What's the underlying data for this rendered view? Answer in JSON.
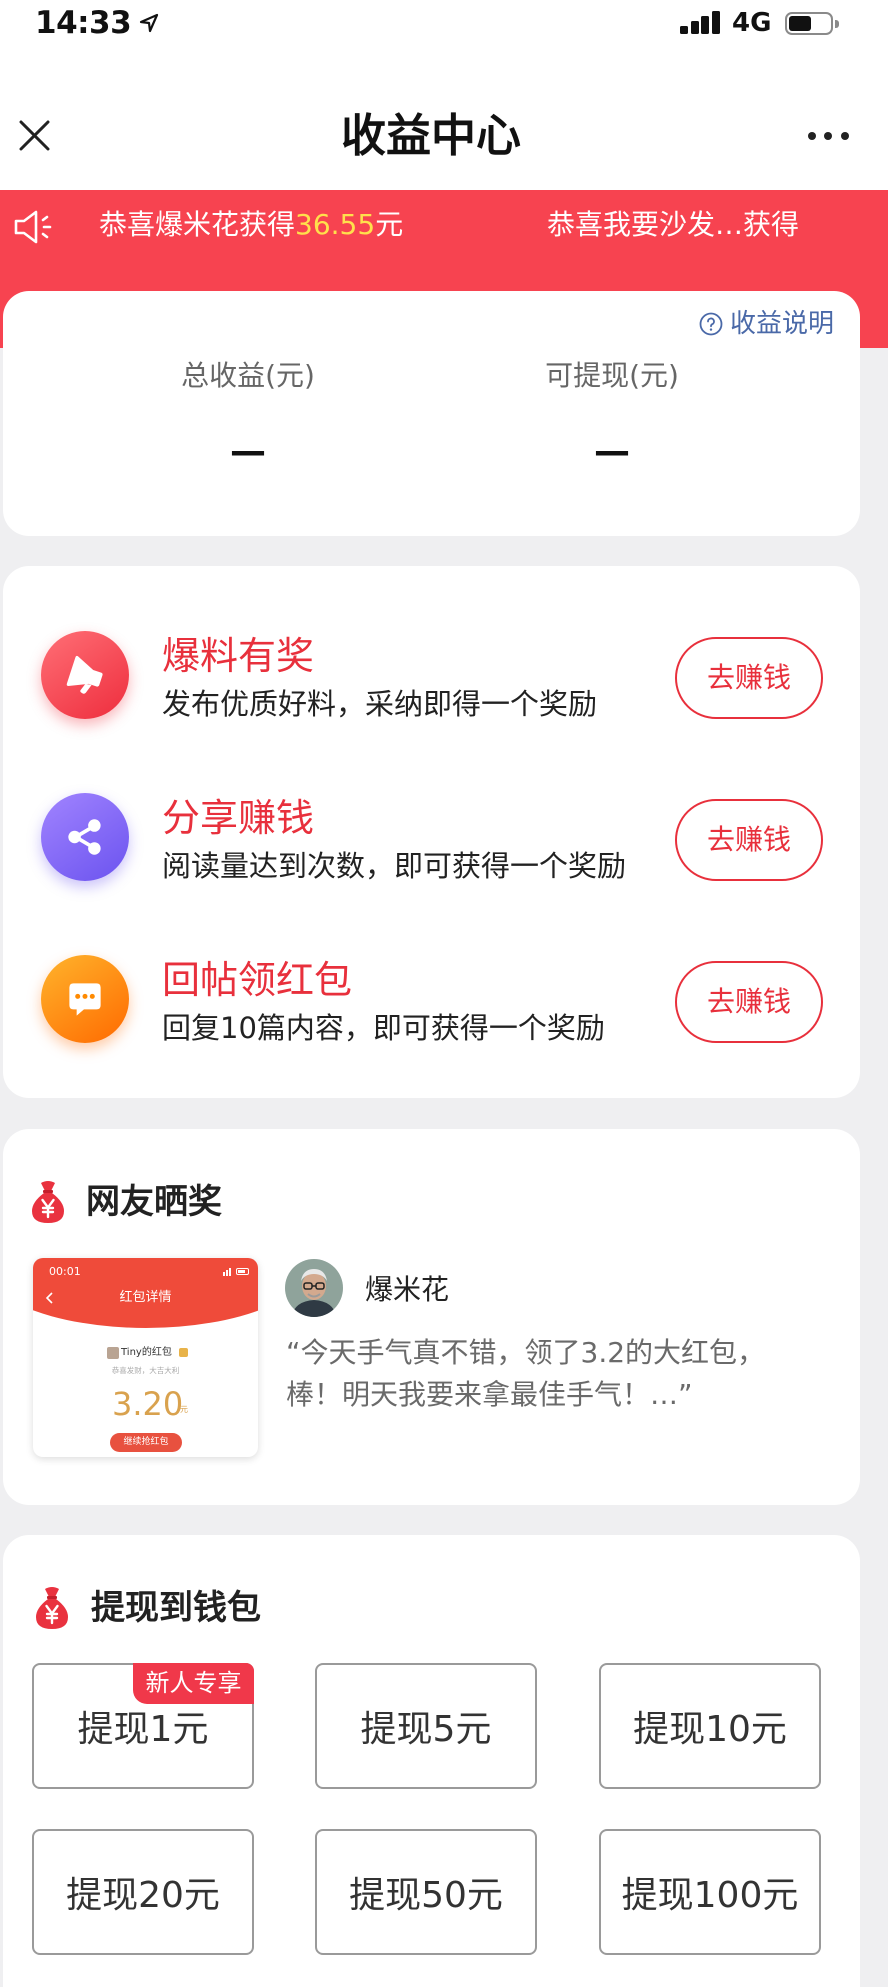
{
  "status_bar": {
    "time": "14:33",
    "network": "4G",
    "battery_level": 0.5
  },
  "header": {
    "title": "收益中心",
    "close_icon": "close-icon",
    "more_icon": "more-icon"
  },
  "ticker": {
    "icon": "speaker-icon",
    "items": [
      {
        "prefix": "恭喜爆米花获得",
        "amount": "36.55",
        "suffix": "元"
      },
      {
        "text": "恭喜我要沙发…获得"
      }
    ]
  },
  "earnings": {
    "help_label": "收益说明",
    "help_icon": "question-circle-icon",
    "total_label": "总收益(元)",
    "total_value": "—",
    "withdrawable_label": "可提现(元)",
    "withdrawable_value": "—"
  },
  "tasks": [
    {
      "icon": "megaphone-icon",
      "title": "爆料有奖",
      "desc": "发布优质好料，采纳即得一个奖励",
      "button": "去赚钱"
    },
    {
      "icon": "share-icon",
      "title": "分享赚钱",
      "desc": "阅读量达到次数，即可获得一个奖励",
      "button": "去赚钱"
    },
    {
      "icon": "chat-bubble-icon",
      "title": "回帖领红包",
      "desc": "回复10篇内容，即可获得一个奖励",
      "button": "去赚钱"
    }
  ],
  "showcase": {
    "icon": "money-bag-icon",
    "title": "网友晒奖",
    "user_name": "爆米花",
    "quote_lines": [
      "“今天手气真不错，领了3.2的大红包，",
      "棒！明天我要来拿最佳手气！…”"
    ],
    "thumbnail": {
      "time": "00:01",
      "title": "红包详情",
      "owner": "Tiny的红包",
      "greeting": "恭喜发财，大吉大利",
      "amount": "3.20",
      "unit": "元",
      "button": "继续抢红包"
    }
  },
  "withdraw": {
    "icon": "money-bag-icon",
    "title": "提现到钱包",
    "badge": "新人专享",
    "options": [
      "提现1元",
      "提现5元",
      "提现10元",
      "提现20元",
      "提现50元",
      "提现100元"
    ]
  },
  "colors": {
    "brand_red": "#f74350",
    "ticker_highlight": "#ffe04c",
    "link_blue": "#4a69a8",
    "task_title_red": "#e8303c",
    "amount_gold": "#d9a24e"
  }
}
